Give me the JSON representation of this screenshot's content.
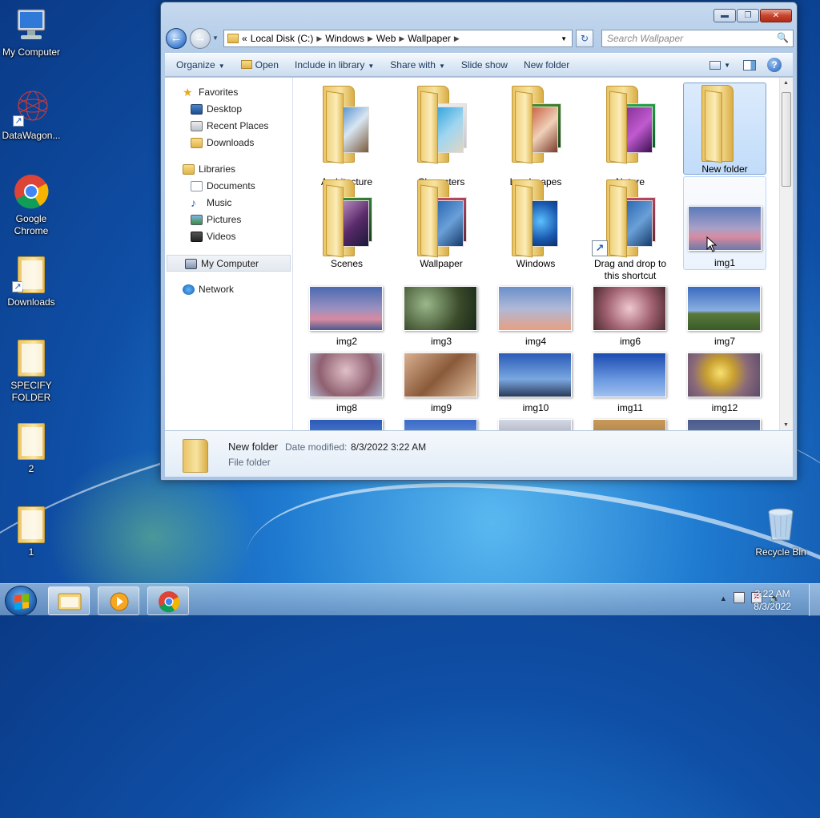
{
  "desktop": {
    "icons": [
      {
        "label": "My Computer"
      },
      {
        "label": "DataWagon..."
      },
      {
        "label": "Google Chrome"
      },
      {
        "label": "Downloads"
      },
      {
        "label": "SPECIFY FOLDER"
      },
      {
        "label": "2"
      },
      {
        "label": "1"
      },
      {
        "label": "Recycle Bin"
      }
    ]
  },
  "window": {
    "controls": {
      "minimize": "▬",
      "maximize": "❐",
      "close": "✕"
    },
    "nav": {
      "back": "←",
      "forward": "→",
      "history": "▼"
    },
    "address": {
      "overflow": "«",
      "crumbs": [
        "Local Disk (C:)",
        "Windows",
        "Web",
        "Wallpaper"
      ],
      "separator": "▶",
      "dropdown": "▼",
      "refresh": "↻"
    },
    "search": {
      "placeholder": "Search Wallpaper",
      "icon": "🔍"
    },
    "toolbar": {
      "organize": "Organize",
      "open": "Open",
      "include_in_library": "Include in library",
      "share_with": "Share with",
      "slide_show": "Slide show",
      "new_folder": "New folder",
      "caret": "▼",
      "help": "?"
    },
    "navpane": {
      "favorites": "Favorites",
      "desktop": "Desktop",
      "recent_places": "Recent Places",
      "downloads": "Downloads",
      "libraries": "Libraries",
      "documents": "Documents",
      "music": "Music",
      "pictures": "Pictures",
      "videos": "Videos",
      "my_computer": "My Computer",
      "network": "Network"
    },
    "files": {
      "folders": [
        "Architecture",
        "Characters",
        "Landscapes",
        "Nature",
        "New folder",
        "Scenes",
        "Wallpaper",
        "Windows"
      ],
      "shortcut": "Drag and drop to this shortcut",
      "images": [
        "img1",
        "img2",
        "img3",
        "img4",
        "img6",
        "img7",
        "img8",
        "img9",
        "img10",
        "img11",
        "img12"
      ]
    },
    "details": {
      "name": "New folder",
      "date_label": "Date modified:",
      "date_value": "8/3/2022 3:22 AM",
      "type": "File folder"
    }
  },
  "taskbar": {
    "tray_arrow": "▲",
    "time": "3:22 AM",
    "date": "8/3/2022"
  },
  "colors": {
    "selection": "#c1dcfa",
    "window_frame": "#b3cce8",
    "desktop_blue": "#1f7bd0"
  }
}
